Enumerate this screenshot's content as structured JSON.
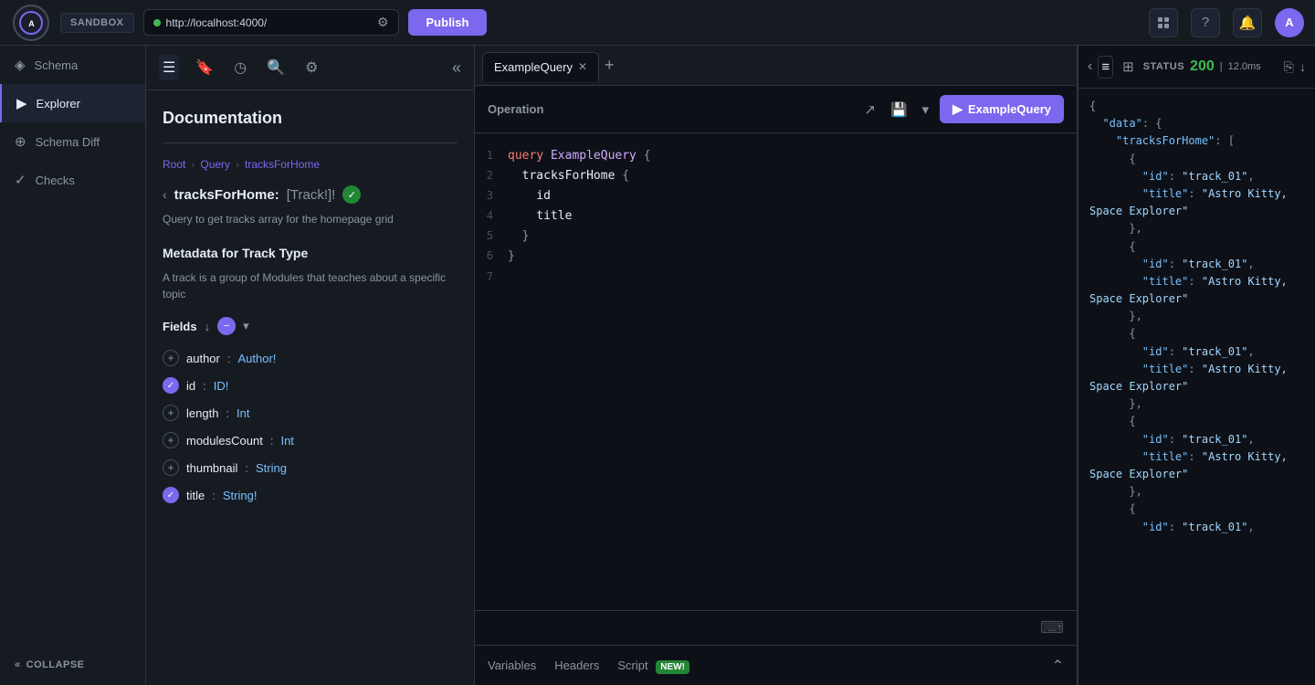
{
  "topbar": {
    "sandbox_label": "SANDBOX",
    "url": "http://localhost:4000/",
    "publish_label": "Publish",
    "logo_text": "APOLLO"
  },
  "sidebar": {
    "items": [
      {
        "label": "Schema",
        "icon": "◈"
      },
      {
        "label": "Explorer",
        "icon": "▶",
        "active": true
      },
      {
        "label": "Schema Diff",
        "icon": "≠"
      },
      {
        "label": "Checks",
        "icon": "✓"
      }
    ],
    "collapse_label": "COLLAPSE"
  },
  "doc_panel": {
    "title": "Documentation",
    "breadcrumb": [
      "Root",
      "Query",
      "tracksForHome"
    ],
    "query_name": "tracksForHome:",
    "query_type": "[Track!]!",
    "query_desc": "Query to get tracks array for the homepage grid",
    "metadata_title": "Metadata for Track Type",
    "metadata_desc": "A track is a group of Modules that teaches about a specific topic",
    "fields_label": "Fields",
    "fields": [
      {
        "name": "author",
        "colon": ":",
        "type": "Author!",
        "checked": false
      },
      {
        "name": "id",
        "colon": ":",
        "type": "ID!",
        "checked": true
      },
      {
        "name": "length",
        "colon": ":",
        "type": "Int",
        "checked": false
      },
      {
        "name": "modulesCount",
        "colon": ":",
        "type": "Int",
        "checked": false
      },
      {
        "name": "thumbnail",
        "colon": ":",
        "type": "String",
        "checked": false
      },
      {
        "name": "title",
        "colon": ":",
        "type": "String!",
        "checked": true
      }
    ]
  },
  "editor": {
    "tab_label": "ExampleQuery",
    "operation_label": "Operation",
    "run_btn_label": "ExampleQuery",
    "code_lines": [
      {
        "num": 1,
        "content": "query ExampleQuery {"
      },
      {
        "num": 2,
        "content": "  tracksForHome {"
      },
      {
        "num": 3,
        "content": "    id"
      },
      {
        "num": 4,
        "content": "    title"
      },
      {
        "num": 5,
        "content": "  }"
      },
      {
        "num": 6,
        "content": "}"
      },
      {
        "num": 7,
        "content": ""
      }
    ],
    "bottom_tabs": [
      {
        "label": "Variables"
      },
      {
        "label": "Headers"
      },
      {
        "label": "Script",
        "badge": "NEW!"
      }
    ]
  },
  "response": {
    "status_label": "STATUS",
    "status_code": "200",
    "time": "12.0ms",
    "json_content": [
      "{\n  \"data\": {\n    \"tracksForHome\": [\n      {\n        \"id\": \"track_01\",\n        \"title\": \"Astro Kitty, Space Explorer\"\n      },\n      {\n        \"id\": \"track_01\",\n        \"title\": \"Astro Kitty, Space Explorer\"\n      },\n      {\n        \"id\": \"track_01\",\n        \"title\": \"Astro Kitty, Space Explorer\"\n      },\n      {\n        \"id\": \"track_01\",\n        \"title\": \"Astro Kitty, Space Explorer\"\n      },\n      {\n        \"id\": \"track_01\","
    ]
  }
}
